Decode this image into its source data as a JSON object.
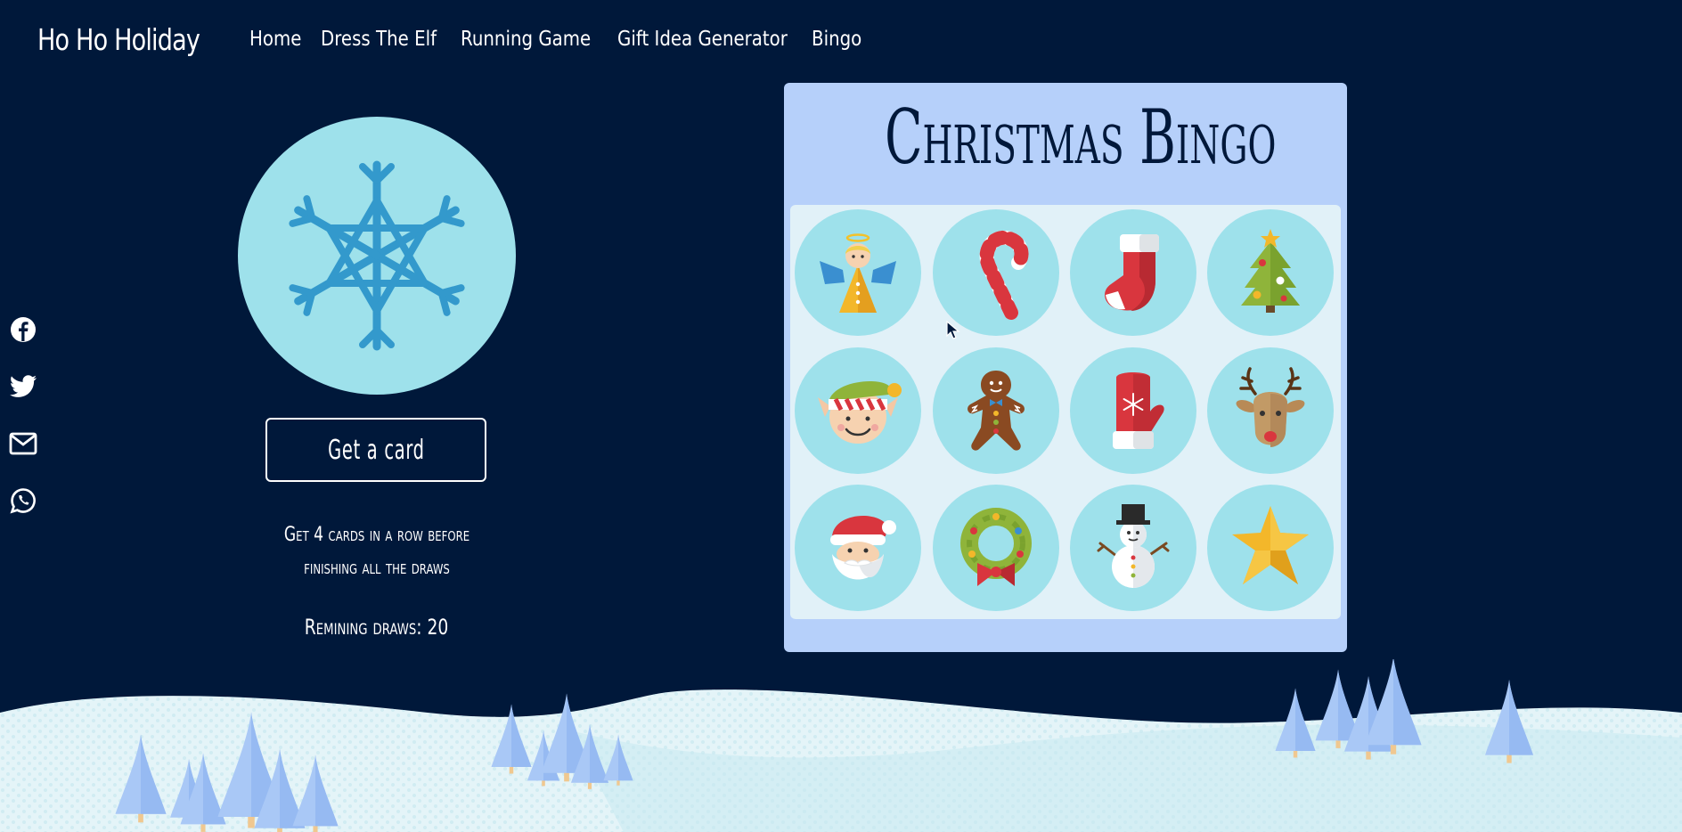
{
  "nav": {
    "brand": "Ho Ho Holiday",
    "links": [
      "Home",
      "Dress The Elf",
      "Running Game",
      "Gift Idea Generator",
      "Bingo"
    ]
  },
  "social": [
    "facebook-icon",
    "twitter-icon",
    "email-icon",
    "whatsapp-icon"
  ],
  "game": {
    "button_label": "Get a card",
    "instructions": "Get 4 cards in a row before finishing all the draws",
    "remaining": "Remining draws: 20"
  },
  "bingo": {
    "title": "Christmas Bingo",
    "cells": [
      "angel-icon",
      "candy-cane-icon",
      "stocking-icon",
      "christmas-tree-icon",
      "elf-icon",
      "gingerbread-man-icon",
      "mitten-icon",
      "reindeer-icon",
      "santa-icon",
      "wreath-icon",
      "snowman-icon",
      "star-icon"
    ]
  },
  "colors": {
    "background": "#00183a",
    "panel": "#b6d0fa",
    "grid": "#e1f1f8",
    "circle": "#9ee1eb",
    "snowflake": "#3399cc"
  }
}
